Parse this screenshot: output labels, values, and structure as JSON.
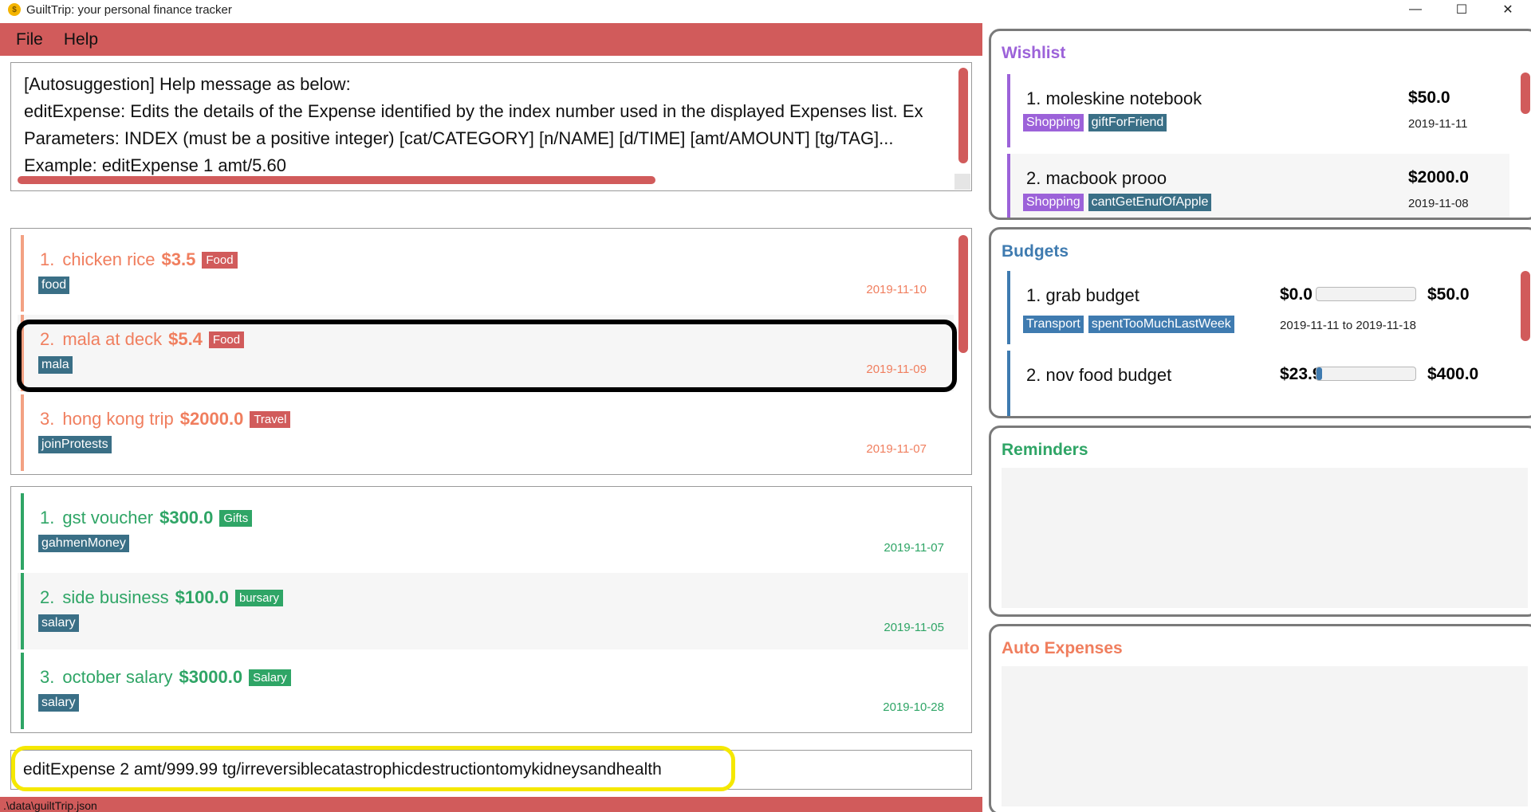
{
  "window": {
    "title": "GuiltTrip: your personal finance tracker",
    "icon_label": "$",
    "controls": [
      "—",
      "☐",
      "✕"
    ]
  },
  "menu": {
    "file": "File",
    "help": "Help"
  },
  "result_display": {
    "lines": [
      "[Autosuggestion] Help message as below:",
      "editExpense: Edits the details of the Expense identified by the index number used in the displayed Expenses list. Ex",
      "Parameters: INDEX (must be a positive integer) [cat/CATEGORY] [n/NAME] [d/TIME] [amt/AMOUNT] [tg/TAG]...",
      "Example: editExpense 1 amt/5.60"
    ]
  },
  "expenses": [
    {
      "index": "1.",
      "name": "chicken rice",
      "amount": "$3.5",
      "category": "Food",
      "tag": "food",
      "date": "2019-11-10"
    },
    {
      "index": "2.",
      "name": "mala at deck",
      "amount": "$5.4",
      "category": "Food",
      "tag": "mala",
      "date": "2019-11-09"
    },
    {
      "index": "3.",
      "name": "hong kong trip",
      "amount": "$2000.0",
      "category": "Travel",
      "tag": "joinProtests",
      "date": "2019-11-07"
    }
  ],
  "incomes": [
    {
      "index": "1.",
      "name": "gst voucher",
      "amount": "$300.0",
      "category": "Gifts",
      "tag": "gahmenMoney",
      "date": "2019-11-07"
    },
    {
      "index": "2.",
      "name": "side business",
      "amount": "$100.0",
      "category": "bursary",
      "tag": "salary",
      "date": "2019-11-05"
    },
    {
      "index": "3.",
      "name": "october salary",
      "amount": "$3000.0",
      "category": "Salary",
      "tag": "salary",
      "date": "2019-10-28"
    }
  ],
  "command": {
    "value": "editExpense 2 amt/999.99 tg/irreversiblecatastrophicdestructiontomykidneysandhealth"
  },
  "status": {
    "path": ".\\data\\guiltTrip.json"
  },
  "wishlist": {
    "title": "Wishlist",
    "items": [
      {
        "label": "1.  moleskine notebook",
        "price": "$50.0",
        "date": "2019-11-11",
        "tags": [
          "Shopping",
          "giftForFriend"
        ]
      },
      {
        "label": "2.  macbook prooo",
        "price": "$2000.0",
        "date": "2019-11-08",
        "tags": [
          "Shopping",
          "cantGetEnufOfApple"
        ]
      }
    ]
  },
  "budgets": {
    "title": "Budgets",
    "items": [
      {
        "label": "1.  grab budget",
        "spent": "$0.0",
        "limit": "$50.0",
        "period": "2019-11-11 to 2019-11-18",
        "tags": [
          "Transport",
          "spentTooMuchLastWeek"
        ],
        "progress_percent": 0
      },
      {
        "label": "2.  nov food budget",
        "spent": "$23.9",
        "limit": "$400.0",
        "period": "",
        "tags": [],
        "progress_percent": 6
      }
    ]
  },
  "reminders": {
    "title": "Reminders"
  },
  "auto_expenses": {
    "title": "Auto Expenses"
  },
  "colors": {
    "accent": "#d15b5b",
    "expense_text": "#f07e5e",
    "income_text": "#2fa566",
    "tag": "#3a6f86",
    "wishlist": "#9c62d9",
    "budget": "#3f7bb0",
    "reminders": "#2fa566",
    "auto_expenses": "#f07e5e",
    "command_highlight": "#f5e800"
  }
}
